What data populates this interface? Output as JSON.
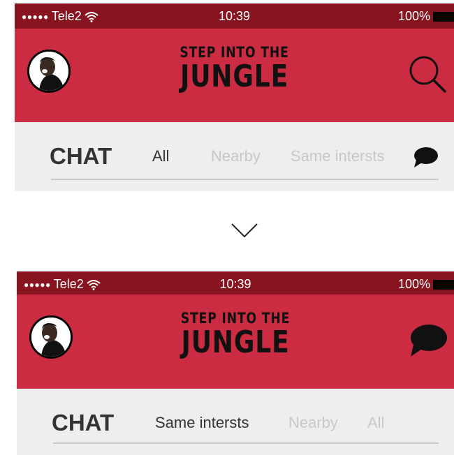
{
  "status_bar": {
    "signal": "●●●●●",
    "carrier": "Tele2",
    "time": "10:39",
    "battery": "100%"
  },
  "header": {
    "logo_line1": "STEP INTO THE",
    "logo_line2": "JUNGLE"
  },
  "screen_before": {
    "tab_title": "CHAT",
    "tabs": [
      "All",
      "Nearby",
      "Same intersts"
    ],
    "active_tab": "All"
  },
  "screen_after": {
    "tab_title": "CHAT",
    "tabs": [
      "Same intersts",
      "Nearby",
      "All"
    ],
    "active_tab": "Same intersts"
  },
  "colors": {
    "status_bar": "#87141e",
    "header": "#cc2c41",
    "tab_bar": "#eeeeee",
    "active_text": "#333333",
    "inactive_text": "#c8c8c8"
  },
  "icons": [
    "avatar",
    "search-icon",
    "chat-bubble-icon",
    "chevron-down-icon",
    "wifi-icon",
    "battery-icon"
  ]
}
